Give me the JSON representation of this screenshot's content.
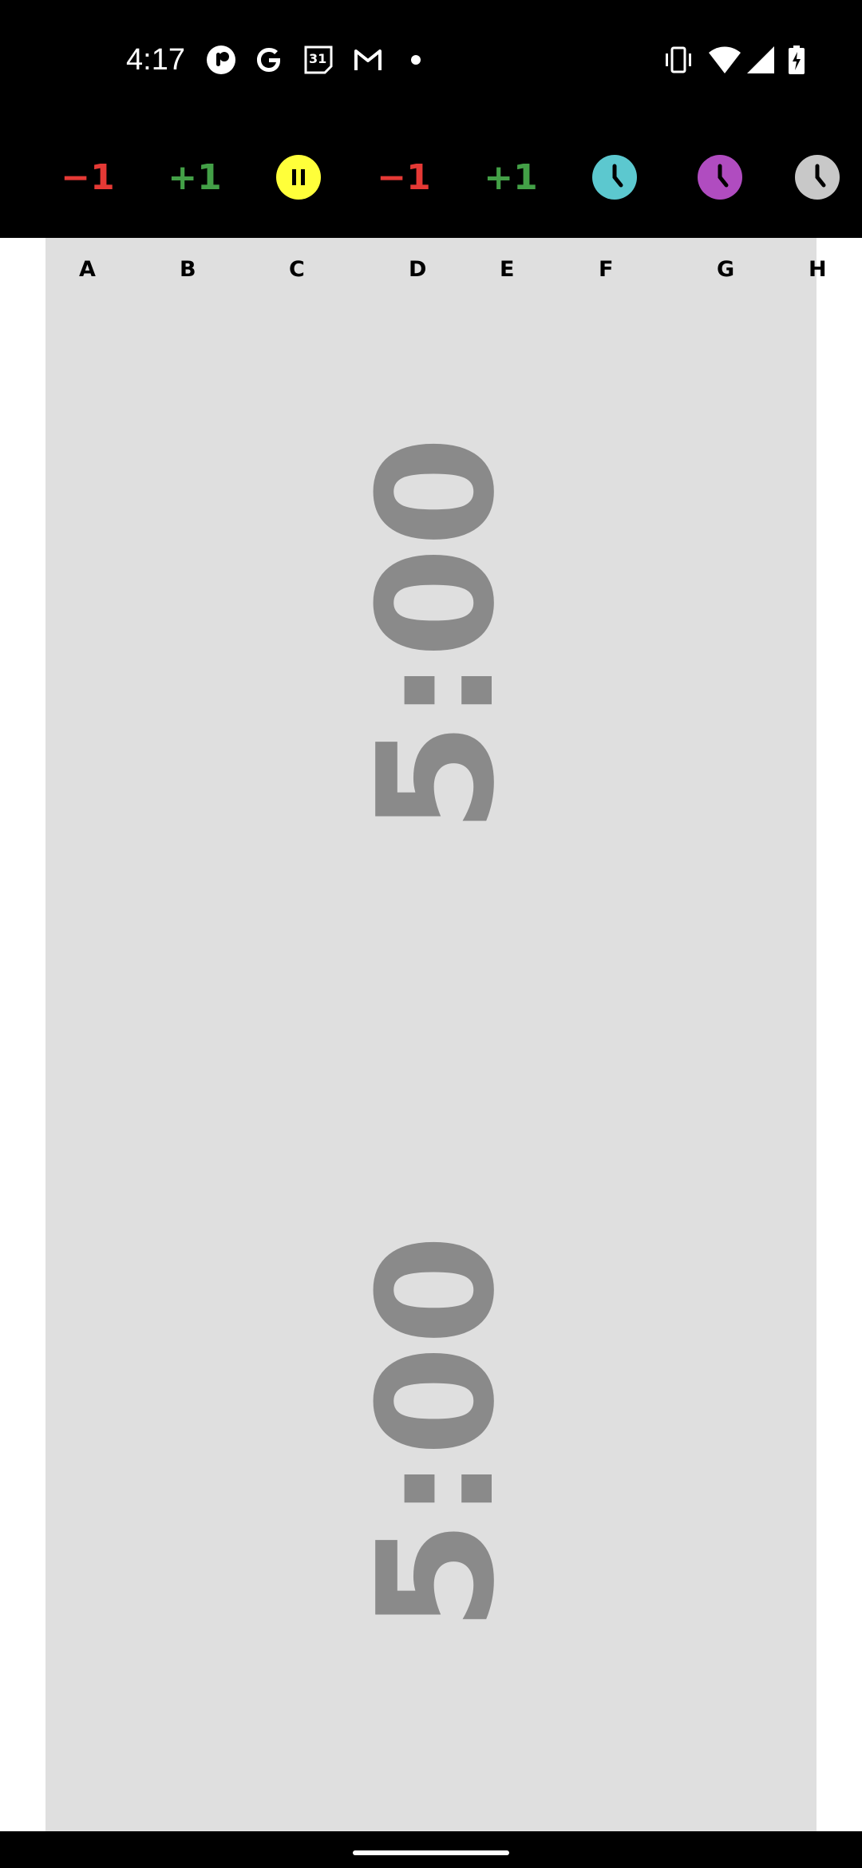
{
  "status_bar": {
    "time": "4:17",
    "icons": [
      "assistant-icon",
      "google-icon",
      "calendar-icon",
      "gmail-icon",
      "dot-icon",
      "vibrate-icon",
      "wifi-icon",
      "signal-icon",
      "battery-charging-icon"
    ],
    "calendar_day": "31"
  },
  "toolbar": {
    "buttons": [
      {
        "label": "−1",
        "color": "#e53935"
      },
      {
        "label": "+1",
        "color": "#43a047"
      },
      {
        "icon": "pause-icon",
        "color": "#ffff3a"
      },
      {
        "label": "−1",
        "color": "#e53935"
      },
      {
        "label": "+1",
        "color": "#43a047"
      },
      {
        "icon": "clock-icon",
        "color": "#5cc8cf"
      },
      {
        "icon": "clock-icon",
        "color": "#b04cc0"
      },
      {
        "icon": "clock-icon",
        "color": "#c8c8c8"
      }
    ]
  },
  "columns": [
    "A",
    "B",
    "C",
    "D",
    "E",
    "F",
    "G",
    "H"
  ],
  "timers": {
    "top": "5:00",
    "bottom": "5:00"
  },
  "colors": {
    "panel_bg": "#dfdfdf",
    "timer_text": "#8a8a8a"
  }
}
